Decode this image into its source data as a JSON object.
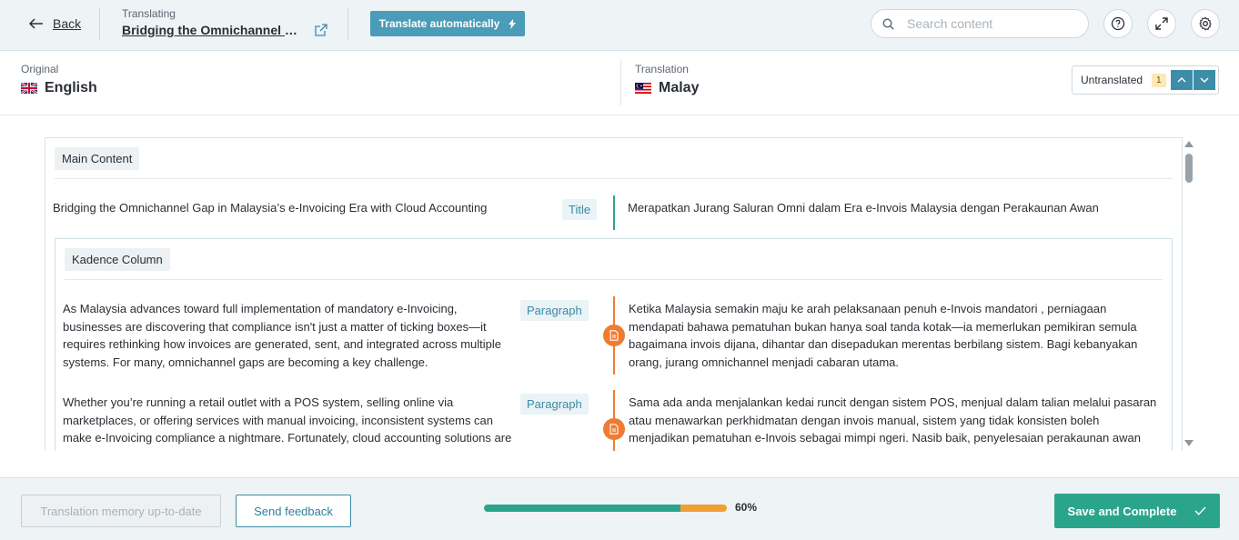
{
  "header": {
    "back_label": "Back",
    "translating_label": "Translating",
    "document_title": "Bridging the Omnichannel Gap in Malaysia's e-Invoicing Era with Cloud Accounting",
    "translate_auto_label": "Translate automatically",
    "search": {
      "placeholder": "Search content",
      "value": ""
    }
  },
  "languages": {
    "original_label": "Original",
    "original_name": "English",
    "translation_label": "Translation",
    "translation_name": "Malay",
    "untranslated_label": "Untranslated",
    "untranslated_count": "1"
  },
  "content": {
    "main_group_label": "Main Content",
    "title_segment": {
      "source": "Bridging the Omnichannel Gap in Malaysia’s e-Invoicing Era with Cloud Accounting",
      "type": "Title",
      "target": "Merapatkan Jurang Saluran Omni dalam Era e-Invois Malaysia dengan Perakaunan Awan"
    },
    "column_group_label": "Kadence Column",
    "paragraphs": [
      {
        "source": "As Malaysia advances toward full implementation of mandatory e-Invoicing, businesses are discovering that compliance isn't just a matter of ticking boxes—it requires rethinking how invoices are generated, sent, and integrated across multiple systems. For many, omnichannel gaps are becoming a key challenge.",
        "type": "Paragraph",
        "target": "Ketika Malaysia semakin maju ke arah pelaksanaan penuh e-Invois mandatori , perniagaan mendapati bahawa pematuhan bukan hanya soal tanda kotak—ia memerlukan pemikiran semula bagaimana invois dijana, dihantar dan disepadukan merentas berbilang sistem. Bagi kebanyakan orang, jurang omnichannel menjadi cabaran utama."
      },
      {
        "source": "Whether you’re running a retail outlet with a POS system, selling online via marketplaces, or offering services with manual invoicing, inconsistent systems can make e-Invoicing compliance a nightmare. Fortunately, cloud accounting solutions are",
        "type": "Paragraph",
        "target": "Sama ada anda menjalankan kedai runcit dengan sistem POS, menjual dalam talian melalui pasaran atau menawarkan perkhidmatan dengan invois manual, sistem yang tidak konsisten boleh menjadikan pematuhan e-Invois sebagai mimpi ngeri. Nasib baik, penyelesaian perakaunan awan"
      }
    ]
  },
  "footer": {
    "tm_label": "Translation memory up-to-date",
    "feedback_label": "Send feedback",
    "progress_percent_label": "60%",
    "progress_translated": 0.81,
    "progress_pending": 0.19,
    "save_label": "Save and Complete"
  },
  "colors": {
    "accent": "#4a9cb8",
    "success": "#2aa58c",
    "warning": "#f07b33",
    "progress_pending": "#f0a032"
  }
}
